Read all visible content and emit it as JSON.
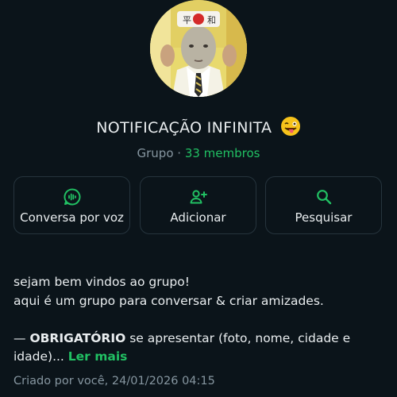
{
  "group": {
    "name": "NOTIFICAÇÃO INFINITA",
    "emoji": "winking-face-tongue-emoji",
    "type_label": "Grupo",
    "separator": " · ",
    "members_label": "33 membros"
  },
  "actions": [
    {
      "label": "Conversa por voz",
      "icon": "voice-chat-icon"
    },
    {
      "label": "Adicionar",
      "icon": "add-person-icon"
    },
    {
      "label": "Pesquisar",
      "icon": "search-icon"
    }
  ],
  "description": {
    "line1": "sejam bem vindos ao grupo!",
    "line2": "aqui é um grupo para conversar & criar amizades.",
    "dash": "— ",
    "bold_word": "OBRIGATÓRIO",
    "rest": " se apresentar (foto, nome, cidade e idade)... ",
    "read_more": "Ler mais"
  },
  "created": "Criado por você, 24/01/2026 04:15",
  "colors": {
    "background": "#0b141a",
    "accent_green": "#21c063",
    "muted_text": "#8696a0",
    "card_border": "#26343d"
  }
}
